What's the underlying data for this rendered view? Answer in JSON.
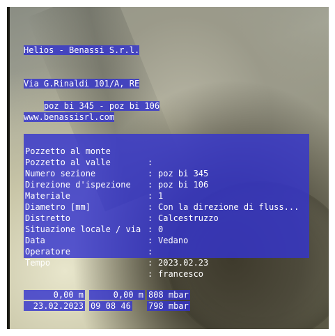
{
  "header": {
    "company": "Helios - Benassi S.r.l.",
    "address": "Via G.Rinaldi 101/A, RE",
    "website": "www.benassisrl.com"
  },
  "section": {
    "title": "poz bi 345 - poz bi 106"
  },
  "info_table": [
    {
      "label": "Pozzetto al monte",
      "value": "poz bi 345"
    },
    {
      "label": "Pozzetto al valle",
      "value": "poz bi 106"
    },
    {
      "label": "Numero sezione",
      "value": "1"
    },
    {
      "label": "Direzione d'ispezione",
      "value": "Con la direzione di fluss..."
    },
    {
      "label": "Materiale",
      "value": "Calcestruzzo"
    },
    {
      "label": "Diametro [mm]",
      "value": "0"
    },
    {
      "label": "Distretto",
      "value": "Vedano"
    },
    {
      "label": "Situazione locale / via",
      "value": ""
    },
    {
      "label": "Data",
      "value": "2023.02.23"
    },
    {
      "label": "Operatore",
      "value": "francesco"
    },
    {
      "label": "Tempo",
      "value": ""
    }
  ],
  "separator": ":",
  "status": {
    "distance_1": "0,00 m",
    "distance_2": "0,00 m",
    "pressure_1": "808 mbar",
    "date": "23.02.2023",
    "time": "09 08 46",
    "pressure_2": "798 mbar"
  }
}
